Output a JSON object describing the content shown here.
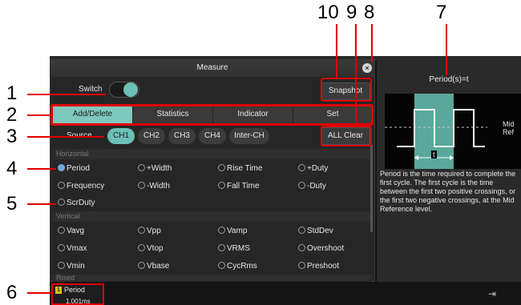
{
  "dialog": {
    "title": "Measure",
    "switch_label": "Switch",
    "snapshot_label": "Snapshot",
    "all_clear_label": "ALL Clear",
    "source_label": "Source",
    "tabs": [
      "Add/Delete",
      "Statistics",
      "Indicator",
      "Set"
    ],
    "sources": [
      "CH1",
      "CH2",
      "CH3",
      "CH4",
      "Inter-CH"
    ],
    "sections": {
      "horizontal": "Horizontal",
      "vertical": "Vertical",
      "third": "Rised"
    },
    "horizontal_options": [
      [
        "Period",
        "+Width",
        "Rise Time",
        "+Duty"
      ],
      [
        "Frequency",
        "-Width",
        "Fall Time",
        "-Duty"
      ],
      [
        "ScrDuty"
      ]
    ],
    "vertical_options": [
      [
        "Vavg",
        "Vpp",
        "Vamp",
        "StdDev"
      ],
      [
        "Vmax",
        "Vtop",
        "VRMS",
        "Overshoot"
      ],
      [
        "Vmin",
        "Vbase",
        "CycRms",
        "Preshoot"
      ]
    ]
  },
  "info": {
    "title": "Period(s)=t",
    "mid_ref_line1": "Mid",
    "mid_ref_line2": "Ref",
    "t_label": "t",
    "description": "Period is the time required to complete the first cycle. The first cycle is the time between the first two positive crossings, or the first two negative crossings, at the Mid Reference level."
  },
  "bottom": {
    "channel": "1",
    "measure_name": "Period",
    "measure_value": "1.001ms"
  },
  "callouts": [
    "1",
    "2",
    "3",
    "4",
    "5",
    "6",
    "7",
    "8",
    "9",
    "10"
  ],
  "colors": {
    "accent": "#6cc0b5",
    "callout": "#e10000",
    "ch1": "#e8c21c",
    "selected_radio": "#6ea9e0"
  }
}
